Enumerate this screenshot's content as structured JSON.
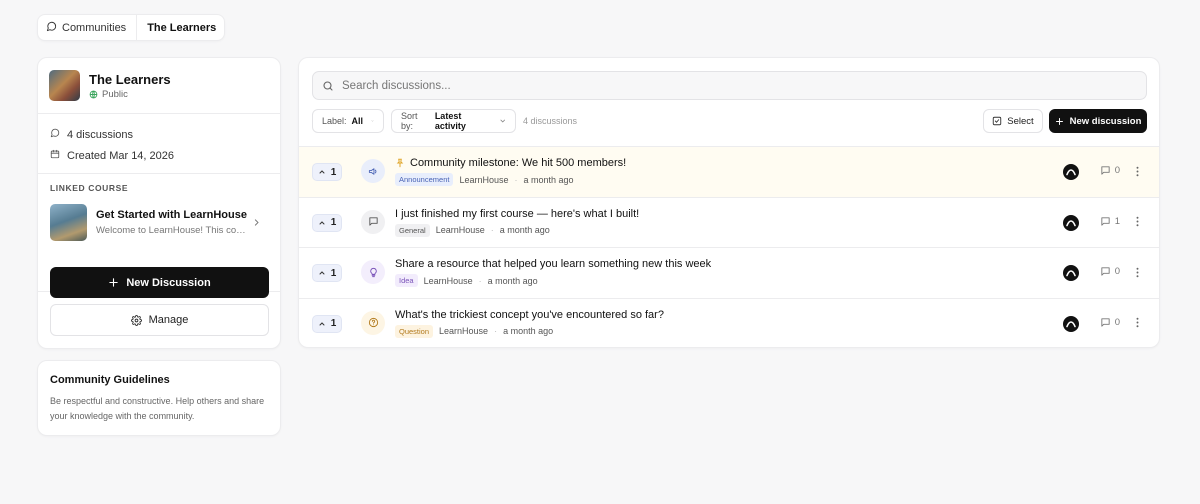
{
  "breadcrumb": {
    "root_label": "Communities",
    "current_label": "The Learners"
  },
  "community": {
    "name": "The Learners",
    "visibility": "Public",
    "discussions_count_text": "4 discussions",
    "created_text": "Created Mar 14, 2026"
  },
  "linked_course": {
    "heading": "LINKED COURSE",
    "name": "Get Started with LearnHouse",
    "description": "Welcome to LearnHouse! This course will guide you through the platform"
  },
  "sidebar_actions": {
    "new_discussion_label": "New Discussion",
    "manage_label": "Manage"
  },
  "guidelines": {
    "title": "Community Guidelines",
    "text": "Be respectful and constructive. Help others and share your knowledge with the community."
  },
  "search": {
    "placeholder": "Search discussions..."
  },
  "filters": {
    "label_prefix": "Label:",
    "label_value": "All",
    "sort_prefix": "Sort by:",
    "sort_value": "Latest activity",
    "count_text": "4 discussions",
    "select_label": "Select",
    "new_discussion_label": "New discussion"
  },
  "discussions": [
    {
      "votes": "1",
      "icon": "megaphone-icon",
      "pinned": true,
      "title": "Community milestone: We hit 500 members!",
      "tag": "Announcement",
      "author": "LearnHouse",
      "time": "a month ago",
      "comments": "0"
    },
    {
      "votes": "1",
      "icon": "message-icon",
      "pinned": false,
      "title": "I just finished my first course — here's what I built!",
      "tag": "General",
      "author": "LearnHouse",
      "time": "a month ago",
      "comments": "1"
    },
    {
      "votes": "1",
      "icon": "lightbulb-icon",
      "pinned": false,
      "title": "Share a resource that helped you learn something new this week",
      "tag": "Idea",
      "author": "LearnHouse",
      "time": "a month ago",
      "comments": "0"
    },
    {
      "votes": "1",
      "icon": "help-circle-icon",
      "pinned": false,
      "title": "What's the trickiest concept you've encountered so far?",
      "tag": "Question",
      "author": "LearnHouse",
      "time": "a month ago",
      "comments": "0"
    }
  ],
  "colors": {
    "primary_button": "#111111",
    "pinned_row_bg": "#fffcf2",
    "pin_icon": "#e0a62a",
    "vote_bg": "#eef1fb",
    "public_globe": "#3aa55c"
  }
}
